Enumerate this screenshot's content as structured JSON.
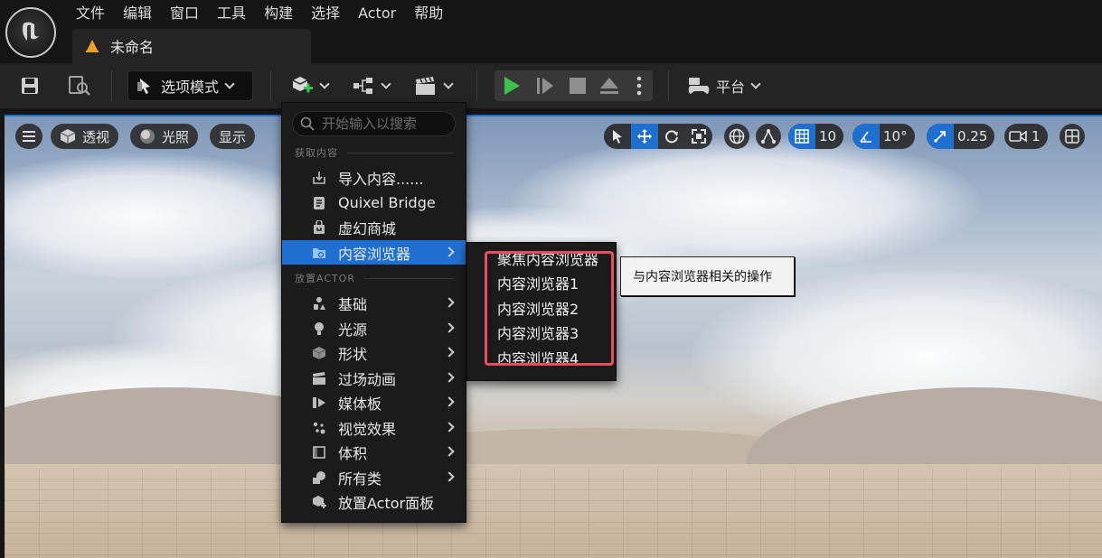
{
  "menubar": {
    "items": [
      "文件",
      "编辑",
      "窗口",
      "工具",
      "构建",
      "选择",
      "Actor",
      "帮助"
    ]
  },
  "document_tab": {
    "title": "未命名"
  },
  "toolbar": {
    "mode_label": "选项模式",
    "platform_label": "平台"
  },
  "viewport": {
    "perspective_label": "透视",
    "lighting_label": "光照",
    "show_label": "显示",
    "grid_snap_value": "10",
    "rotation_snap_value": "10°",
    "scale_snap_value": "0.25",
    "camera_speed_value": "1"
  },
  "add_menu": {
    "search_placeholder": "开始输入以搜索",
    "section_get_content": "获取内容",
    "section_place_actor": "放置ACTOR",
    "get_content_items": [
      {
        "label": "导入内容......",
        "icon": "import-icon",
        "submenu": false
      },
      {
        "label": "Quixel Bridge",
        "icon": "bridge-icon",
        "submenu": false
      },
      {
        "label": "虚幻商城",
        "icon": "marketplace-icon",
        "submenu": false
      },
      {
        "label": "内容浏览器",
        "icon": "folder-icon",
        "submenu": true,
        "highlighted": true
      }
    ],
    "place_actor_items": [
      {
        "label": "基础",
        "icon": "basic-icon",
        "submenu": true
      },
      {
        "label": "光源",
        "icon": "light-icon",
        "submenu": true
      },
      {
        "label": "形状",
        "icon": "shape-icon",
        "submenu": true
      },
      {
        "label": "过场动画",
        "icon": "cinematic-icon",
        "submenu": true
      },
      {
        "label": "媒体板",
        "icon": "media-icon",
        "submenu": true
      },
      {
        "label": "视觉效果",
        "icon": "vfx-icon",
        "submenu": true
      },
      {
        "label": "体积",
        "icon": "volume-icon",
        "submenu": true
      },
      {
        "label": "所有类",
        "icon": "all-classes-icon",
        "submenu": true
      },
      {
        "label": "放置Actor面板",
        "icon": "place-actor-icon",
        "submenu": false
      }
    ]
  },
  "content_browser_submenu": {
    "items": [
      "聚焦内容浏览器",
      "内容浏览器1",
      "内容浏览器2",
      "内容浏览器3",
      "内容浏览器4"
    ]
  },
  "tooltip": {
    "text": "与内容浏览器相关的操作"
  },
  "colors": {
    "accent": "#1f6fd0",
    "highlight_box": "#e94d5f",
    "play_green": "#3cc24a",
    "warning_orange": "#f0a020"
  }
}
